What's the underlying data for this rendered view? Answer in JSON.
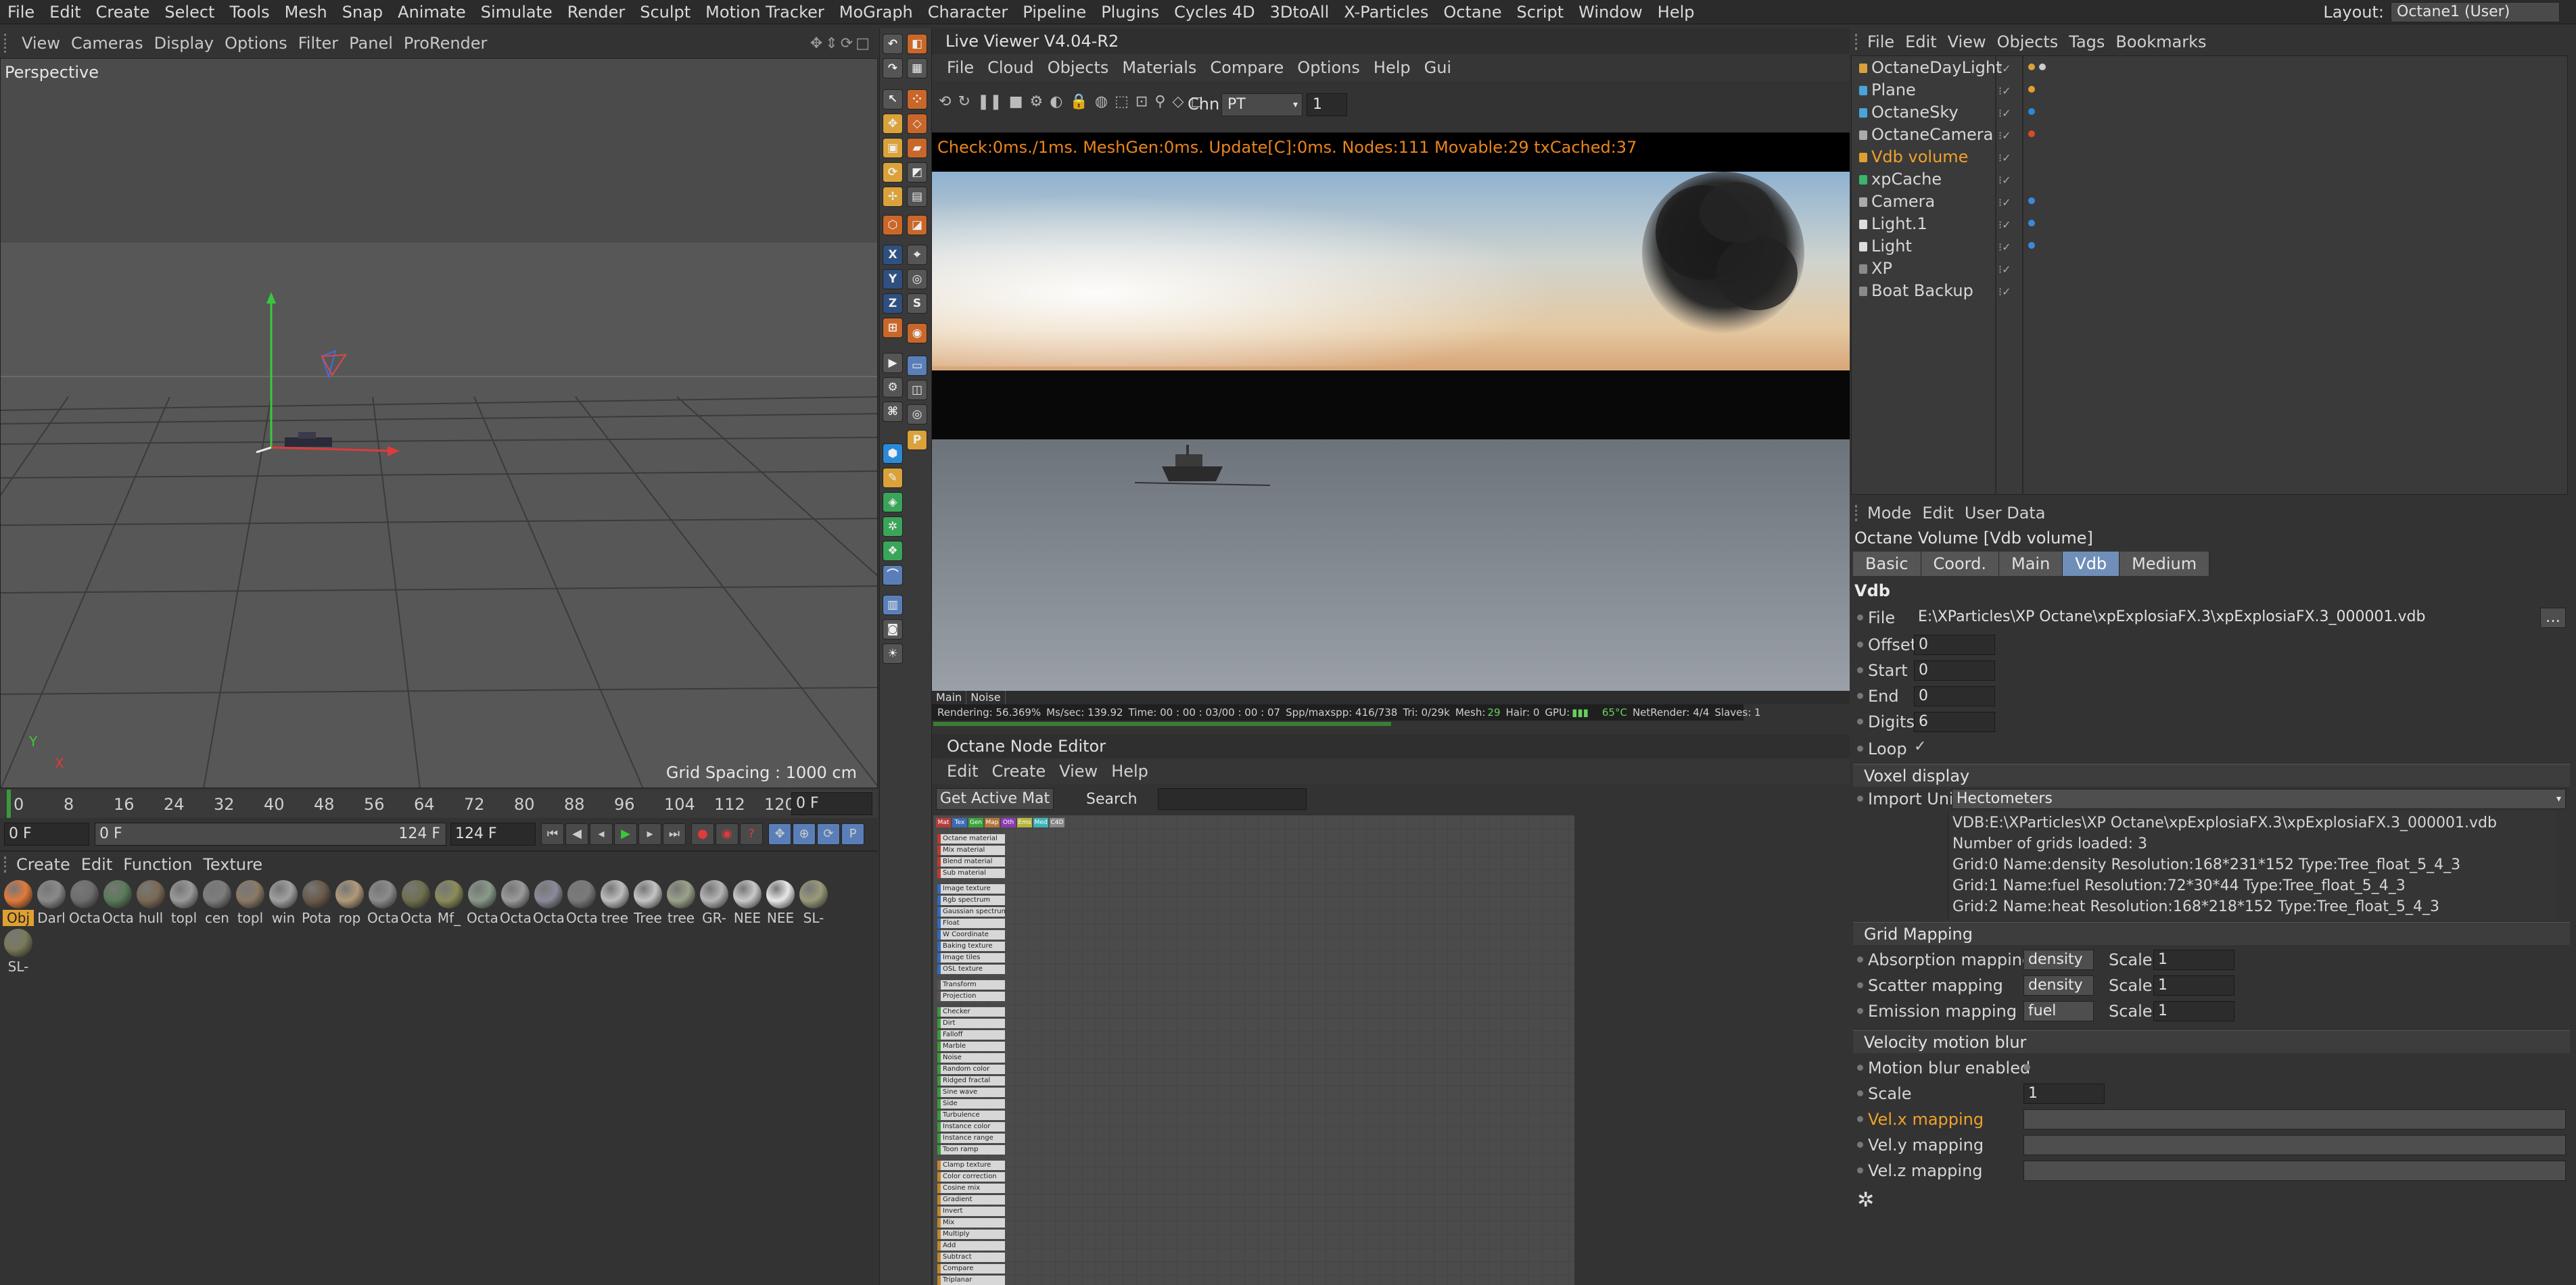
{
  "menubar": {
    "items": [
      "File",
      "Edit",
      "Create",
      "Select",
      "Tools",
      "Mesh",
      "Snap",
      "Animate",
      "Simulate",
      "Render",
      "Sculpt",
      "Motion Tracker",
      "MoGraph",
      "Character",
      "Pipeline",
      "Plugins",
      "Cycles 4D",
      "3DtoAll",
      "X-Particles",
      "Octane",
      "Script",
      "Window",
      "Help"
    ],
    "layout_label": "Layout:",
    "layout_value": "Octane1 (User)"
  },
  "viewport": {
    "menu": [
      "View",
      "Cameras",
      "Display",
      "Options",
      "Filter",
      "Panel",
      "ProRender"
    ],
    "label": "Perspective",
    "grid_spacing": "Grid Spacing : 1000 cm",
    "axis_y": "Y",
    "axis_x": "X"
  },
  "timeline": {
    "ticks": [
      "0",
      "8",
      "16",
      "24",
      "32",
      "40",
      "48",
      "56",
      "64",
      "72",
      "80",
      "88",
      "96",
      "104",
      "112",
      "120"
    ],
    "current_frame": "0 F",
    "start_frame": "0 F",
    "range_start": "0 F",
    "range_end": "124 F",
    "end_frame": "124 F"
  },
  "materials": {
    "menu": [
      "Create",
      "Edit",
      "Function",
      "Texture"
    ],
    "items": [
      {
        "name": "Obj",
        "color": "#e07a3c"
      },
      {
        "name": "Darl",
        "color": "#8a8a8a"
      },
      {
        "name": "Octa",
        "color": "#6e6e6e"
      },
      {
        "name": "Octa",
        "color": "#5a7a5a"
      },
      {
        "name": "hull",
        "color": "#7a6a55"
      },
      {
        "name": "topl",
        "color": "#9a9a9a"
      },
      {
        "name": "cen",
        "color": "#7d7d7d"
      },
      {
        "name": "topl",
        "color": "#8a7a66"
      },
      {
        "name": "win",
        "color": "#a0a0a0"
      },
      {
        "name": "Pota",
        "color": "#6a5a4a"
      },
      {
        "name": "rop",
        "color": "#b09a7a"
      },
      {
        "name": "Octa",
        "color": "#8c8c8c"
      },
      {
        "name": "Octa",
        "color": "#70704f"
      },
      {
        "name": "Mf_",
        "color": "#8b8b5a"
      },
      {
        "name": "Octa",
        "color": "#8a9a8a"
      },
      {
        "name": "Octa",
        "color": "#9a9a9a"
      },
      {
        "name": "Octa",
        "color": "#8a8a9a"
      },
      {
        "name": "Octa",
        "color": "#7a7a7a"
      },
      {
        "name": "tree",
        "color": "#bdbdbd"
      },
      {
        "name": "Tree",
        "color": "#c4c4c4"
      },
      {
        "name": "tree",
        "color": "#9aa28a"
      },
      {
        "name": "GR-",
        "color": "#b5b5b5"
      },
      {
        "name": "NEE",
        "color": "#c9c9c9"
      },
      {
        "name": "NEE",
        "color": "#e8e8e8"
      },
      {
        "name": "SL-",
        "color": "#9a9a7a"
      },
      {
        "name": "SL-",
        "color": "#7a7a5a"
      }
    ]
  },
  "live_viewer": {
    "title": "Live Viewer V4.04-R2",
    "menu": [
      "File",
      "Cloud",
      "Objects",
      "Materials",
      "Compare",
      "Options",
      "Help",
      "Gui"
    ],
    "channel_label": "Chn:",
    "channel_value": "PT",
    "channel_number": "1",
    "status": "Check:0ms./1ms. MeshGen:0ms. Update[C]:0ms. Nodes:111 Movable:29 txCached:37",
    "tabs": [
      "Main",
      "Noise"
    ],
    "stats": {
      "rendering": "Rendering: 56.369%",
      "ms": "Ms/sec: 139.92",
      "time": "Time: 00 : 00 : 03/00 : 00 : 07",
      "spp": "Spp/maxspp: 416/738",
      "tri": "Tri: 0/29k",
      "mesh_label": "Mesh:",
      "mesh_value": "29",
      "hair": "Hair: 0",
      "gpu": "GPU:",
      "temp": "65°C",
      "netrender": "NetRender: 4/4",
      "slaves": "Slaves: 1"
    },
    "progress": 0.564
  },
  "node_editor": {
    "title": "Octane Node Editor",
    "menu": [
      "Edit",
      "Create",
      "View",
      "Help"
    ],
    "get_active": "Get Active Mat",
    "search_label": "Search",
    "tabs": [
      {
        "label": "Mat",
        "color": "#b43b3b"
      },
      {
        "label": "Tex",
        "color": "#3b6bb4"
      },
      {
        "label": "Gen",
        "color": "#3ba43b"
      },
      {
        "label": "Map",
        "color": "#b4743b"
      },
      {
        "label": "Oth",
        "color": "#8a3bb4"
      },
      {
        "label": "Ems",
        "color": "#b4b43b"
      },
      {
        "label": "Med",
        "color": "#3bb4b4"
      },
      {
        "label": "C4D",
        "color": "#888888"
      }
    ],
    "node_items": [
      {
        "label": "Octane material",
        "color": "#c0392b"
      },
      {
        "label": "Mix material",
        "color": "#c0392b"
      },
      {
        "label": "Blend material",
        "color": "#c0392b"
      },
      {
        "label": "Sub material",
        "color": "#c0392b"
      },
      {
        "label": "Image texture",
        "color": "#2e6bc0"
      },
      {
        "label": "Rgb spectrum",
        "color": "#2e6bc0"
      },
      {
        "label": "Gaussian spectrum",
        "color": "#2e6bc0"
      },
      {
        "label": "Float",
        "color": "#2e6bc0"
      },
      {
        "label": "W Coordinate",
        "color": "#2e6bc0"
      },
      {
        "label": "Baking texture",
        "color": "#2e6bc0"
      },
      {
        "label": "Image tiles",
        "color": "#2e6bc0"
      },
      {
        "label": "OSL texture",
        "color": "#2e6bc0"
      },
      {
        "label": "Transform",
        "color": "#555555"
      },
      {
        "label": "Projection",
        "color": "#555555"
      },
      {
        "label": "Checker",
        "color": "#3a9a3a"
      },
      {
        "label": "Dirt",
        "color": "#3a9a3a"
      },
      {
        "label": "Falloff",
        "color": "#3a9a3a"
      },
      {
        "label": "Marble",
        "color": "#3a9a3a"
      },
      {
        "label": "Noise",
        "color": "#3a9a3a"
      },
      {
        "label": "Random color",
        "color": "#3a9a3a"
      },
      {
        "label": "Ridged fractal",
        "color": "#3a9a3a"
      },
      {
        "label": "Sine wave",
        "color": "#3a9a3a"
      },
      {
        "label": "Side",
        "color": "#3a9a3a"
      },
      {
        "label": "Turbulence",
        "color": "#3a9a3a"
      },
      {
        "label": "Instance color",
        "color": "#3a9a3a"
      },
      {
        "label": "Instance range",
        "color": "#3a9a3a"
      },
      {
        "label": "Toon ramp",
        "color": "#3a9a3a"
      },
      {
        "label": "Clamp texture",
        "color": "#c0862b"
      },
      {
        "label": "Color correction",
        "color": "#c0862b"
      },
      {
        "label": "Cosine mix",
        "color": "#c0862b"
      },
      {
        "label": "Gradient",
        "color": "#c0862b"
      },
      {
        "label": "Invert",
        "color": "#c0862b"
      },
      {
        "label": "Mix",
        "color": "#c0862b"
      },
      {
        "label": "Multiply",
        "color": "#c0862b"
      },
      {
        "label": "Add",
        "color": "#c0862b"
      },
      {
        "label": "Subtract",
        "color": "#c0862b"
      },
      {
        "label": "Compare",
        "color": "#c0862b"
      },
      {
        "label": "Triplanar",
        "color": "#c0862b"
      }
    ]
  },
  "objects": {
    "menu": [
      "File",
      "Edit",
      "View",
      "Objects",
      "Tags",
      "Bookmarks"
    ],
    "items": [
      {
        "name": "OctaneDayLight",
        "icon": "#d9a23a",
        "highlight": false,
        "tags": [
          "#d9a23a",
          "#cccccc"
        ]
      },
      {
        "name": "Plane",
        "icon": "#4aa3d9",
        "highlight": false,
        "tags": [
          "#e0a030"
        ]
      },
      {
        "name": "OctaneSky",
        "icon": "#4aa3d9",
        "highlight": false,
        "tags": [
          "#2a8ad9"
        ]
      },
      {
        "name": "OctaneCamera",
        "icon": "#aaaaaa",
        "highlight": false,
        "tags": [
          "#d94a2a"
        ]
      },
      {
        "name": "Vdb volume",
        "icon": "#e0a030",
        "highlight": true,
        "tags": []
      },
      {
        "name": "xpCache",
        "icon": "#3ab56a",
        "highlight": false,
        "tags": []
      },
      {
        "name": "Camera",
        "icon": "#aaaaaa",
        "highlight": false,
        "tags": [
          "#3a8ad9"
        ]
      },
      {
        "name": "Light.1",
        "icon": "#dddddd",
        "highlight": false,
        "tags": [
          "#3a8ad9"
        ]
      },
      {
        "name": "Light",
        "icon": "#dddddd",
        "highlight": false,
        "tags": [
          "#3a8ad9"
        ]
      },
      {
        "name": "XP",
        "icon": "#8a8a8a",
        "highlight": false,
        "tags": []
      },
      {
        "name": "Boat Backup",
        "icon": "#8a8a8a",
        "highlight": false,
        "tags": []
      }
    ]
  },
  "attributes": {
    "menu": [
      "Mode",
      "Edit",
      "User Data"
    ],
    "title": "Octane Volume [Vdb volume]",
    "tabs": [
      "Basic",
      "Coord.",
      "Main",
      "Vdb",
      "Medium"
    ],
    "active_tab": "Vdb",
    "section": "Vdb",
    "file_label": "File",
    "file_value": "E:\\XParticles\\XP Octane\\xpExplosiaFX.3\\xpExplosiaFX.3_000001.vdb",
    "offset_label": "Offset",
    "offset_value": "0",
    "start_label": "Start",
    "start_value": "0",
    "end_label": "End",
    "end_value": "0",
    "digits_label": "Digits",
    "digits_value": "6",
    "loop_label": "Loop",
    "voxel_group": "Voxel display",
    "import_unit_label": "Import Unit",
    "import_unit_value": "Hectometers",
    "vdb_info": [
      "VDB:E:\\XParticles\\XP Octane\\xpExplosiaFX.3\\xpExplosiaFX.3_000001.vdb",
      "Number of grids loaded: 3",
      "Grid:0  Name:density  Resolution:168*231*152  Type:Tree_float_5_4_3",
      "Grid:1  Name:fuel  Resolution:72*30*44  Type:Tree_float_5_4_3",
      "Grid:2  Name:heat  Resolution:168*218*152  Type:Tree_float_5_4_3"
    ],
    "grid_mapping_group": "Grid Mapping",
    "absorption_label": "Absorption mapping",
    "absorption_value": "density",
    "scatter_label": "Scatter mapping",
    "scatter_value": "density",
    "emission_label": "Emission mapping",
    "emission_value": "fuel",
    "scale_label": "Scale",
    "scale_value": "1",
    "velocity_group": "Velocity motion blur",
    "motion_blur_label": "Motion blur enabled",
    "vel_scale_label": "Scale",
    "vel_scale_value": "1",
    "velx_label": "Vel.x mapping",
    "vely_label": "Vel.y mapping",
    "velz_label": "Vel.z mapping"
  }
}
